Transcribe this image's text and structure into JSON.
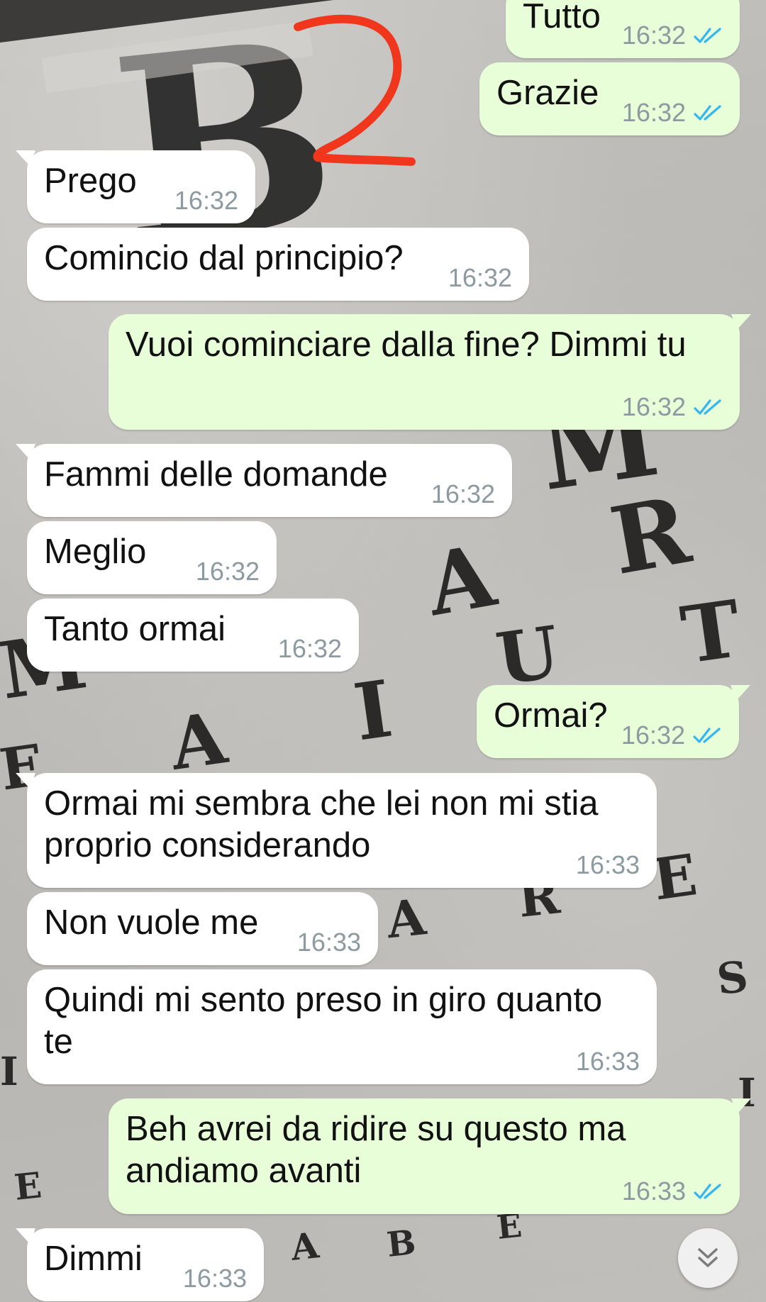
{
  "chat": {
    "messages": [
      {
        "dir": "out",
        "text": "Tutto",
        "time": "16:32",
        "status": "read-double-check"
      },
      {
        "dir": "out",
        "text": "Grazie",
        "time": "16:32",
        "status": "read-double-check"
      },
      {
        "dir": "in",
        "text": "Prego",
        "time": "16:32"
      },
      {
        "dir": "in",
        "text": "Comincio dal principio?",
        "time": "16:32"
      },
      {
        "dir": "out",
        "text": "Vuoi cominciare dalla fine? Dimmi tu",
        "time": "16:32",
        "status": "read-double-check"
      },
      {
        "dir": "in",
        "text": "Fammi delle domande",
        "time": "16:32"
      },
      {
        "dir": "in",
        "text": "Meglio",
        "time": "16:32"
      },
      {
        "dir": "in",
        "text": "Tanto ormai",
        "time": "16:32"
      },
      {
        "dir": "out",
        "text": "Ormai?",
        "time": "16:32",
        "status": "read-double-check"
      },
      {
        "dir": "in",
        "text": "Ormai mi sembra che lei non mi stia\nproprio considerando",
        "time": "16:33"
      },
      {
        "dir": "in",
        "text": "Non vuole me",
        "time": "16:33"
      },
      {
        "dir": "in",
        "text": "Quindi mi sento preso in giro quanto\nte",
        "time": "16:33"
      },
      {
        "dir": "out",
        "text": "Beh avrei da ridire su questo ma\nandiamo avanti",
        "time": "16:33",
        "status": "read-double-check"
      },
      {
        "dir": "in",
        "text": "Dimmi",
        "time": "16:33"
      }
    ]
  },
  "annotation": {
    "text": "2",
    "color": "#f0361d"
  },
  "wallpaper": {
    "letters": [
      "B",
      "M",
      "R",
      "A",
      "T",
      "U",
      "I",
      "A",
      "E",
      "M",
      "E",
      "A",
      "R",
      "S",
      "E",
      "A",
      "B",
      "E",
      "I",
      "I"
    ]
  },
  "scroll_button": {
    "icon": "double-chevron-down-icon"
  },
  "colors": {
    "incoming_bubble": "#ffffff",
    "outgoing_bubble": "#e7fed8",
    "timestamp": "#8d9aa0",
    "read_ticks": "#34b7f1",
    "annotation": "#f0361d"
  }
}
